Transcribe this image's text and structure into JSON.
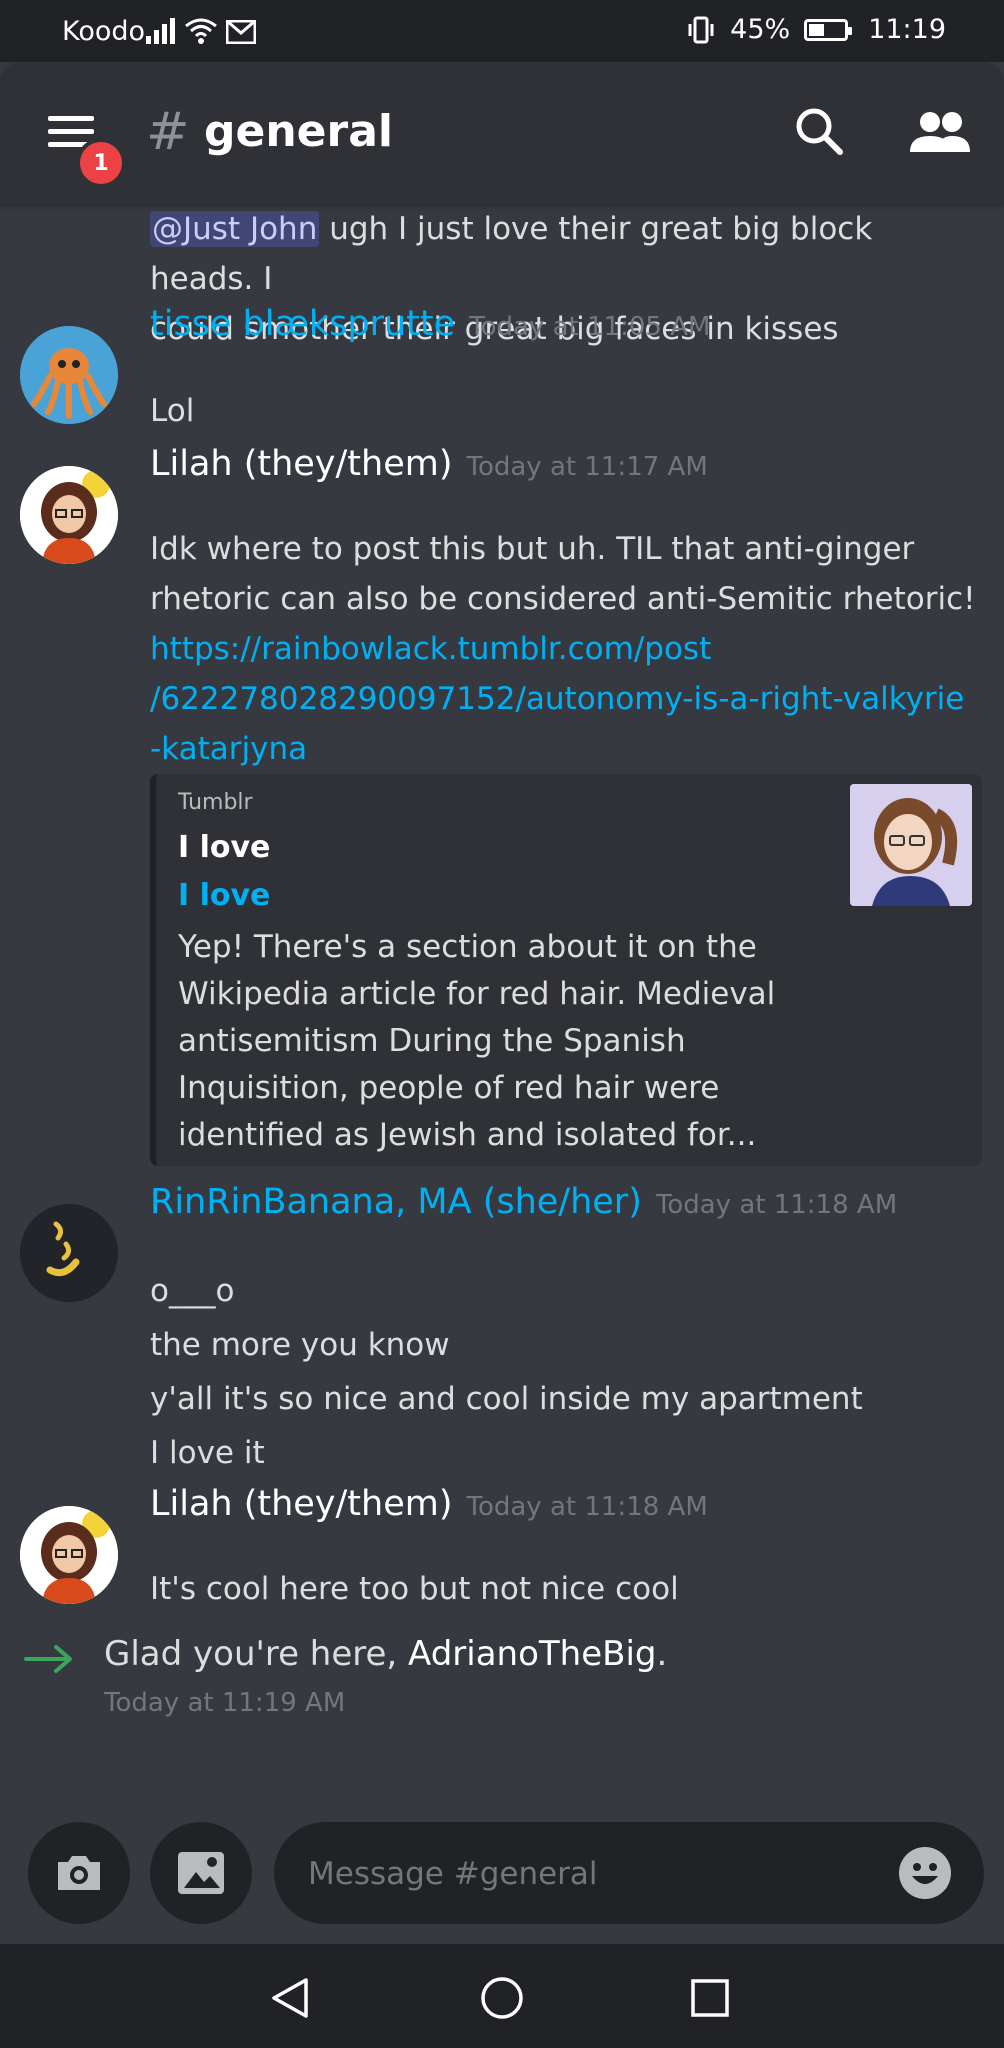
{
  "status_bar": {
    "carrier": "Koodo",
    "battery_percent": "45%",
    "battery_level": 0.45,
    "time": "11:19"
  },
  "header": {
    "notification_badge": "1",
    "channel_hash": "#",
    "channel_name": "general",
    "icons": [
      "menu-icon",
      "search-icon",
      "members-icon"
    ]
  },
  "messages": [
    {
      "continuation": true,
      "mention": "@Just John",
      "line1": " ugh I just love their great big block heads. I",
      "line2": "could smother their great big faces in kisses"
    },
    {
      "author": "tisse blæksprutte",
      "author_color": "#00b0f4",
      "timestamp": "Today at 11:05 AM",
      "lines": [
        "Lol"
      ]
    },
    {
      "author": "Lilah (they/them)",
      "author_color": "#ffffff",
      "timestamp": "Today at 11:17 AM",
      "lines": [
        "Idk where to post this but uh. TIL that anti-ginger",
        "rhetoric can also be considered anti-Semitic rhetoric!"
      ],
      "link_lines": [
        "https://rainbowlack.tumblr.com/post",
        "/622278028290097152/autonomy-is-a-right-valkyrie",
        "-katarjyna"
      ],
      "embed": {
        "provider": "Tumblr",
        "title": "I love f",
        "link_title": "I love f",
        "description_lines": [
          "Yep! There's a section about it on the",
          "Wikipedia article for red hair. Medieval",
          "antisemitism During the Spanish",
          "Inquisition, people of red hair were",
          "identified as Jewish and isolated for..."
        ]
      }
    },
    {
      "author": "RinRinBanana, MA (she/her)",
      "author_color": "#00b0f4",
      "timestamp": "Today at 11:18 AM",
      "lines": [
        "o___o",
        "the more you know",
        "y'all it's so nice and cool inside my apartment",
        "I love it"
      ]
    },
    {
      "author": "Lilah (they/them)",
      "author_color": "#ffffff",
      "timestamp": "Today at 11:18 AM",
      "lines": [
        "It's cool here too but not nice cool"
      ]
    }
  ],
  "system_message": {
    "prefix": "Glad you're here, ",
    "username": "AdrianoTheBig",
    "suffix": ".",
    "timestamp": "Today at 11:19 AM",
    "arrow_color": "#3ba55d"
  },
  "composer": {
    "placeholder": "Message #general",
    "icons": [
      "camera-icon",
      "image-icon",
      "emoji-icon"
    ]
  },
  "nav_bar": {
    "icons": [
      "back-icon",
      "home-icon",
      "recents-icon"
    ]
  },
  "colors": {
    "background": "#36393f",
    "header": "#2f3136",
    "link": "#00b0f4",
    "badge": "#ed4245"
  }
}
